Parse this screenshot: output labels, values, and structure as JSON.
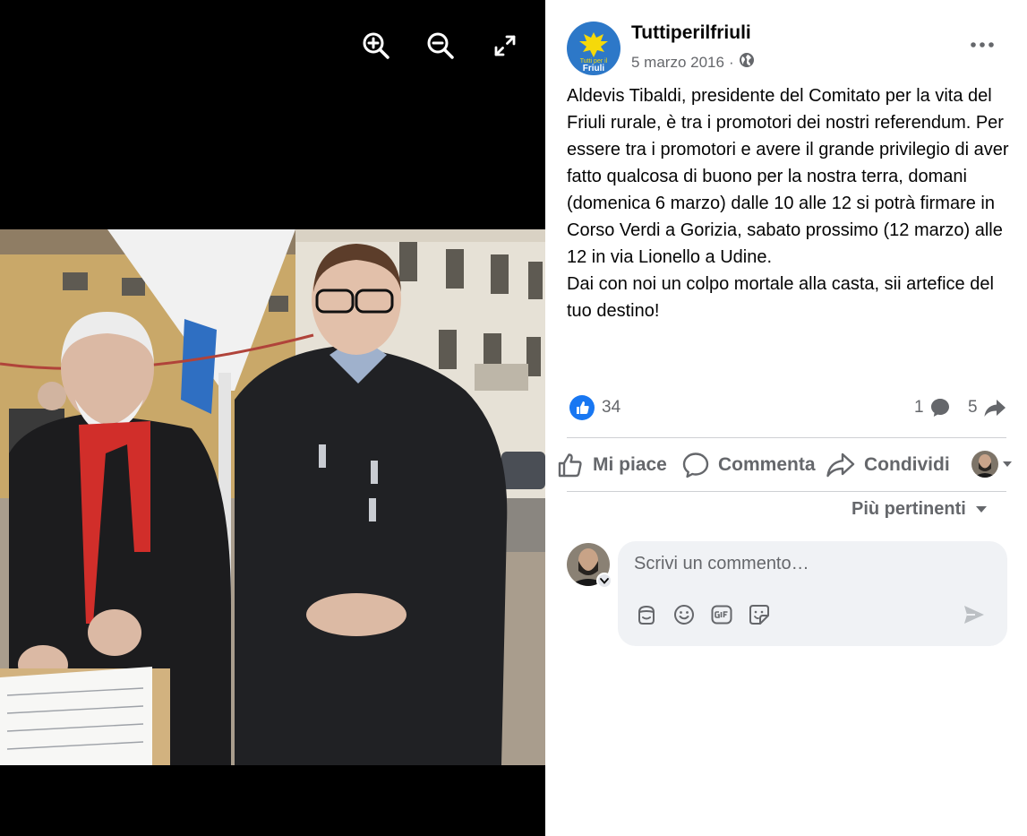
{
  "viewer": {
    "icons": {
      "zoom_in": "zoom-in-icon",
      "zoom_out": "zoom-out-icon",
      "fullscreen": "fullscreen-icon"
    }
  },
  "post": {
    "page_name": "Tuttiperilfriuli",
    "avatar_text_top": "Tutti per il",
    "avatar_text_bottom": "Friuli",
    "date": "5 marzo 2016",
    "separator": "·",
    "privacy_icon": "globe-icon",
    "text": "Aldevis Tibaldi, presidente del Comitato per la vita del Friuli rurale, è tra i promotori dei nostri referendum. Per essere tra i promotori e avere il grande privilegio di aver fatto qualcosa di buono per la nostra terra, domani (domenica 6 marzo) dalle 10 alle 12 si potrà firmare in Corso Verdi a Gorizia, sabato prossimo (12 marzo) alle 12 in via Lionello a Udine.\nDai con noi un colpo mortale alla casta, sii artefice del tuo destino!"
  },
  "stats": {
    "reactions": "34",
    "comments": "1",
    "shares": "5"
  },
  "actions": {
    "like": "Mi piace",
    "comment": "Commenta",
    "share": "Condividi"
  },
  "comments": {
    "sort_label": "Più pertinenti",
    "placeholder": "Scrivi un commento…"
  },
  "colors": {
    "accent": "#1877f2",
    "secondary_text": "#65676b",
    "avatar_blue": "#2d78c8",
    "avatar_yellow": "#f5d90a"
  }
}
